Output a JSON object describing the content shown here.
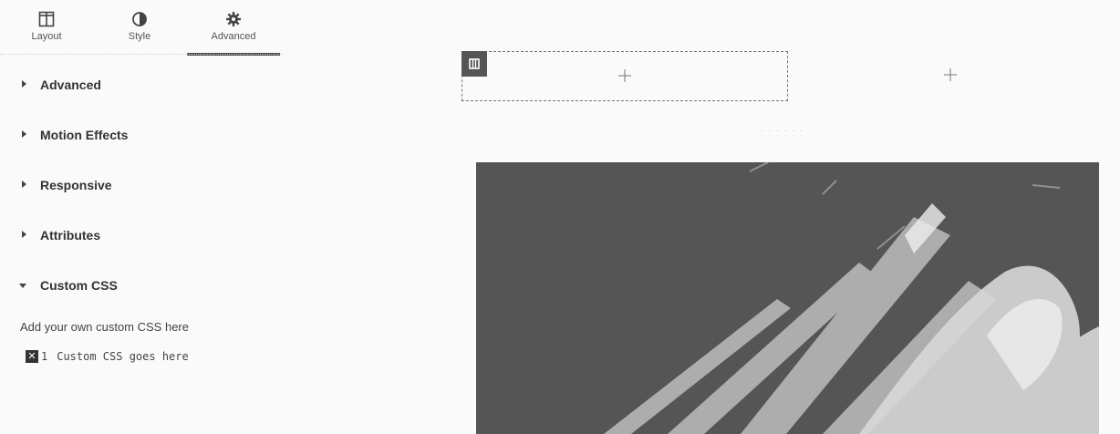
{
  "tabs": [
    {
      "label": "Layout",
      "icon": "layout-icon"
    },
    {
      "label": "Style",
      "icon": "contrast-icon"
    },
    {
      "label": "Advanced",
      "icon": "gear-icon",
      "active": true
    }
  ],
  "sections": [
    {
      "label": "Advanced",
      "expanded": false
    },
    {
      "label": "Motion Effects",
      "expanded": false
    },
    {
      "label": "Responsive",
      "expanded": false
    },
    {
      "label": "Attributes",
      "expanded": false
    },
    {
      "label": "Custom CSS",
      "expanded": true
    }
  ],
  "custom_css": {
    "hint": "Add your own custom CSS here",
    "line_number": "1",
    "code": "Custom CSS goes here"
  },
  "canvas": {
    "column_icon": "column-icon",
    "add_icon": "crosshair-plus-icon",
    "faint_caption": "......"
  },
  "colors": {
    "accent": "#4a4a4a",
    "image_bg": "#555555"
  }
}
